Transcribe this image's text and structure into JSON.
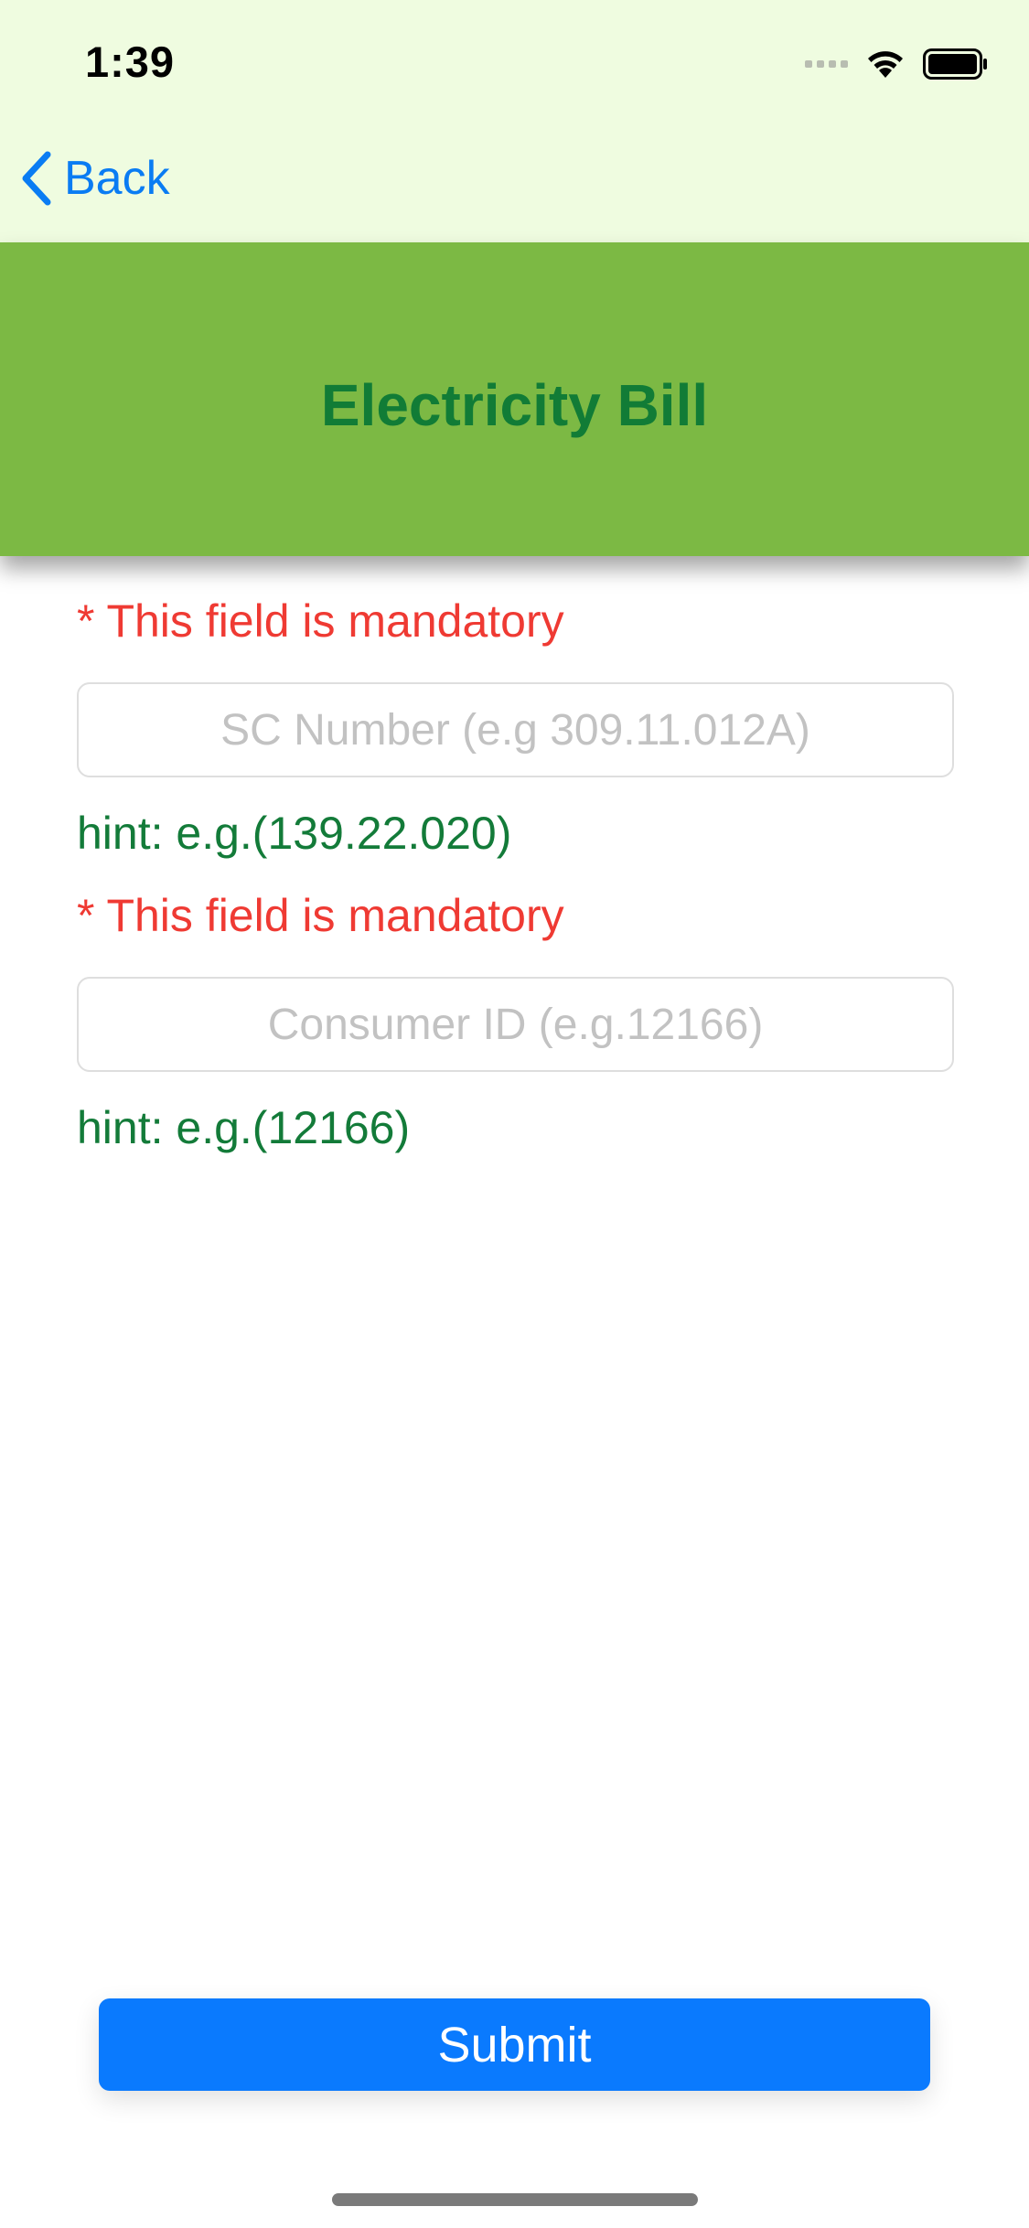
{
  "status_bar": {
    "time": "1:39",
    "icons": [
      "cellular-signal-icon",
      "wifi-icon",
      "battery-icon"
    ]
  },
  "navigation": {
    "back_label": "Back",
    "back_icon": "chevron-left-icon"
  },
  "header": {
    "title": "Electricity Bill"
  },
  "form": {
    "fields": [
      {
        "mandatory_label": "* This field is mandatory",
        "placeholder": "SC Number (e.g 309.11.012A)",
        "value": "",
        "hint": "hint: e.g.(139.22.020)"
      },
      {
        "mandatory_label": "* This field is mandatory",
        "placeholder": "Consumer ID (e.g.12166)",
        "value": "",
        "hint": "hint: e.g.(12166)"
      }
    ],
    "submit_label": "Submit"
  },
  "colors": {
    "top_bar_bg": "#effce0",
    "header_bg": "#7cb944",
    "header_text": "#117c36",
    "mandatory_text": "#ef3a33",
    "hint_text": "#137b39",
    "accent_blue": "#0a7afe",
    "placeholder": "#c2c2c2"
  }
}
